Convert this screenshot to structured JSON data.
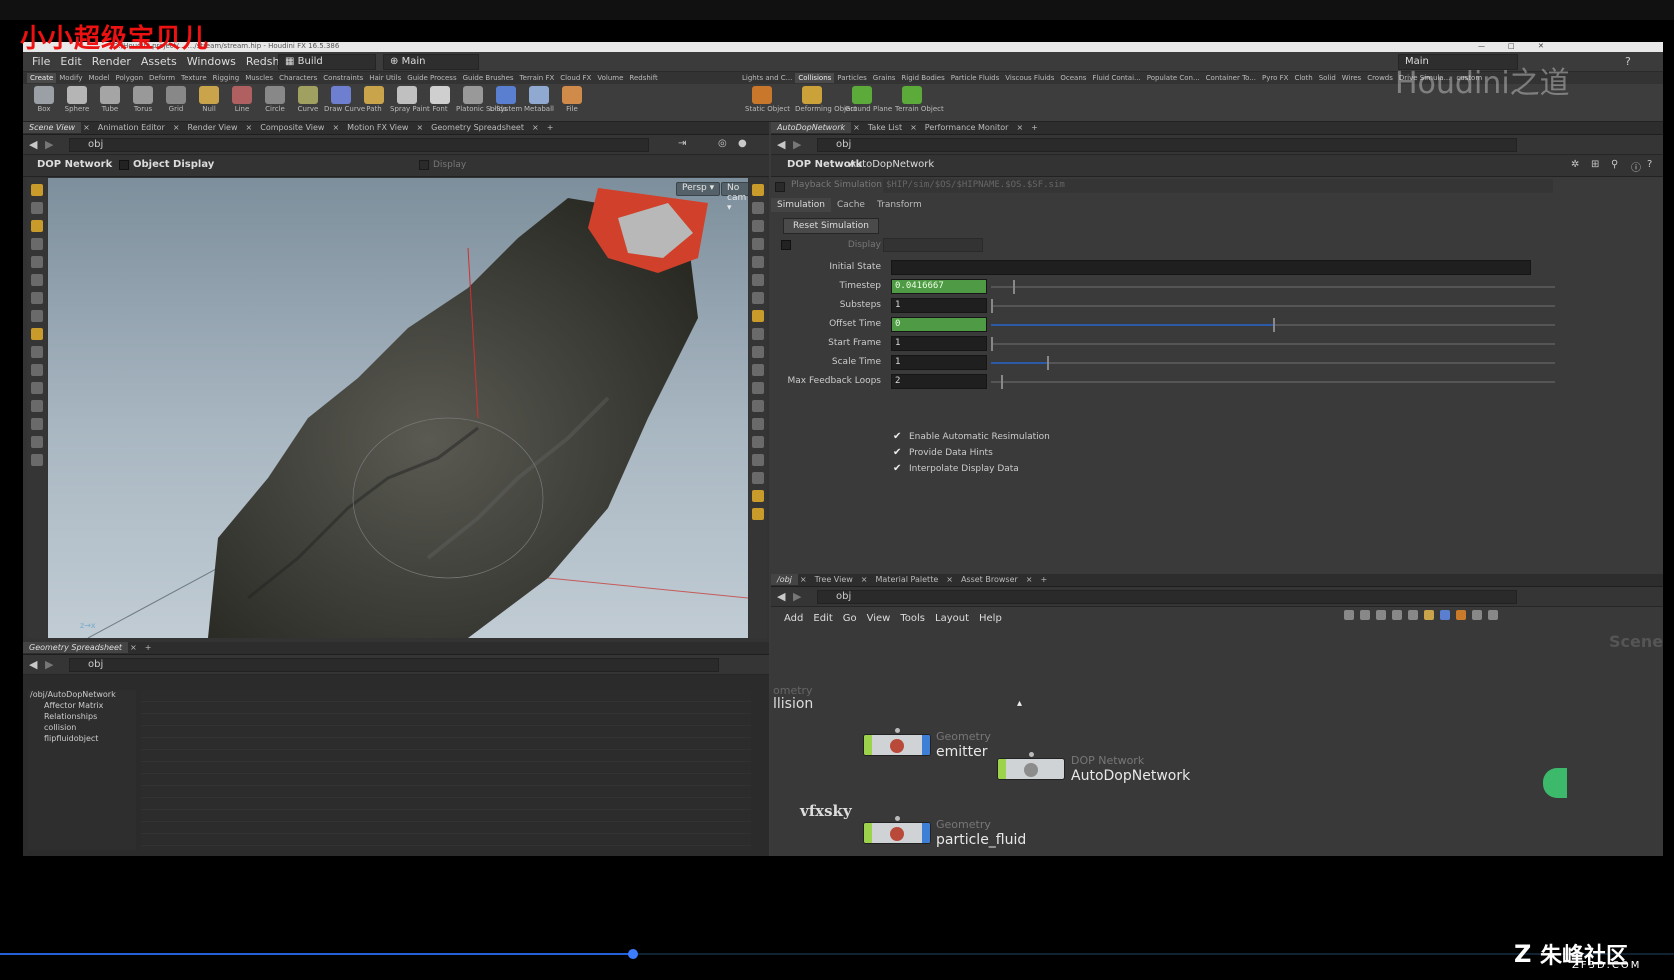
{
  "overlay": {
    "title": "小小超级宝贝儿",
    "watermark_top": "Houdini之道",
    "watermark_mid": "vfxsky",
    "watermark_brand": "朱峰社区",
    "watermark_site": "ZF3D.COM"
  },
  "window": {
    "title_path": "D:/Houdini project/... .../stream/stream.hip - Houdini FX 16.5.386",
    "minimize": "—",
    "maximize": "□",
    "close": "✕"
  },
  "menubar": {
    "items": [
      "File",
      "Edit",
      "Render",
      "Assets",
      "Windows",
      "Redshift",
      "Help"
    ],
    "desktop_left": "Build",
    "desktop_right": "Main",
    "desktop_far": "Main"
  },
  "shelf_tabs_left": [
    "Create",
    "Modify",
    "Model",
    "Polygon",
    "Deform",
    "Texture",
    "Rigging",
    "Muscles",
    "Characters",
    "Constraints",
    "Hair Utils",
    "Guide Process",
    "Guide Brushes",
    "Terrain FX",
    "Cloud FX",
    "Volume",
    "Redshift"
  ],
  "shelf_tabs_right": [
    "Lights and C...",
    "Collisions",
    "Particles",
    "Grains",
    "Rigid Bodies",
    "Particle Fluids",
    "Viscous Fluids",
    "Oceans",
    "Fluid Contai...",
    "Populate Con...",
    "Container To...",
    "Pyro FX",
    "Cloth",
    "Solid",
    "Wires",
    "Crowds",
    "Drive Simula...",
    "custom"
  ],
  "shelf_tools_left": [
    {
      "label": "Box",
      "color": "#9aa0a6"
    },
    {
      "label": "Sphere",
      "color": "#b5b5b5"
    },
    {
      "label": "Tube",
      "color": "#a5a5a5"
    },
    {
      "label": "Torus",
      "color": "#999"
    },
    {
      "label": "Grid",
      "color": "#888"
    },
    {
      "label": "Null",
      "color": "#c9a44a"
    },
    {
      "label": "Line",
      "color": "#b06060"
    },
    {
      "label": "Circle",
      "color": "#888"
    },
    {
      "label": "Curve",
      "color": "#a0a060"
    },
    {
      "label": "Draw Curve",
      "color": "#6f7fd0"
    },
    {
      "label": "Path",
      "color": "#c9a44a"
    },
    {
      "label": "Spray Paint",
      "color": "#c0c0c0"
    },
    {
      "label": "Font",
      "color": "#cfcfcf"
    },
    {
      "label": "Platonic Solids",
      "color": "#999"
    },
    {
      "label": "L-System",
      "color": "#5a7fd0"
    },
    {
      "label": "Metaball",
      "color": "#8fa9d0"
    },
    {
      "label": "File",
      "color": "#d08a4a"
    }
  ],
  "shelf_tools_right": [
    {
      "label": "Static Object",
      "color": "#c9772a"
    },
    {
      "label": "Deforming Object",
      "color": "#cba23a"
    },
    {
      "label": "Ground Plane",
      "color": "#5caa3a"
    },
    {
      "label": "Terrain Object",
      "color": "#5caa3a"
    }
  ],
  "left_pane": {
    "tabs": [
      "Scene View",
      "Animation Editor",
      "Render View",
      "Composite View",
      "Motion FX View",
      "Geometry Spreadsheet"
    ],
    "path": "obj",
    "header_network": "DOP Network",
    "header_display": "Object Display",
    "header_display2": "Display",
    "persp_button": "Persp ▾",
    "cam_button": "No cam ▾",
    "axis_label": "z→x"
  },
  "spreadsheet": {
    "tabs": [
      "Geometry Spreadsheet"
    ],
    "path": "obj",
    "tree": [
      "/obj/AutoDopNetwork",
      "Affector Matrix",
      "Relationships",
      "collision",
      "flipfluidobject"
    ]
  },
  "right_pane": {
    "tabs": [
      "AutoDopNetwork",
      "Take List",
      "Performance Monitor"
    ],
    "path": "obj",
    "node_type": "DOP Network",
    "node_name": "AutoDopNetwork",
    "playback_label": "Playback Simulation",
    "playback_path": "$HIP/sim/$OS/$HIPNAME.$OS.$SF.sim",
    "param_tabs": [
      "Simulation",
      "Cache",
      "Transform"
    ],
    "reset_button": "Reset Simulation",
    "display_label": "Display",
    "params": [
      {
        "label": "Initial State",
        "value": ""
      },
      {
        "label": "Timestep",
        "value": "0.0416667"
      },
      {
        "label": "Substeps",
        "value": "1"
      },
      {
        "label": "Offset Time",
        "value": "0"
      },
      {
        "label": "Start Frame",
        "value": "1"
      },
      {
        "label": "Scale Time",
        "value": "1"
      },
      {
        "label": "Max Feedback Loops",
        "value": "2"
      }
    ],
    "checkboxes": [
      {
        "label": "Enable Automatic Resimulation",
        "checked": true
      },
      {
        "label": "Provide Data Hints",
        "checked": true
      },
      {
        "label": "Interpolate Display Data",
        "checked": true
      }
    ]
  },
  "network_pane": {
    "tabs": [
      "/obj",
      "Tree View",
      "Material Palette",
      "Asset Browser"
    ],
    "path": "obj",
    "menu": [
      "Add",
      "Edit",
      "Go",
      "View",
      "Tools",
      "Layout",
      "Help"
    ],
    "context_label": "Scene",
    "partial_type": "ometry",
    "partial_name": "llision",
    "nodes": [
      {
        "type": "Geometry",
        "name": "emitter"
      },
      {
        "type": "DOP Network",
        "name": "AutoDopNetwork"
      },
      {
        "type": "Geometry",
        "name": "particle_fluid"
      }
    ]
  },
  "video": {
    "progress": 0.378
  }
}
